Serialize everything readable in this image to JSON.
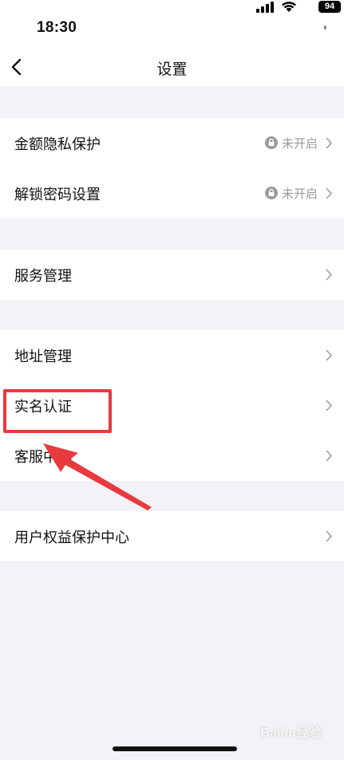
{
  "status_bar": {
    "time": "18:30",
    "battery": "94"
  },
  "nav": {
    "title": "设置"
  },
  "groups": [
    {
      "items": [
        {
          "label": "金额隐私保护",
          "status": "未开启",
          "has_lock": true
        },
        {
          "label": "解锁密码设置",
          "status": "未开启",
          "has_lock": true
        }
      ]
    },
    {
      "items": [
        {
          "label": "服务管理"
        }
      ]
    },
    {
      "items": [
        {
          "label": "地址管理"
        },
        {
          "label": "实名认证"
        },
        {
          "label": "客服中心"
        }
      ]
    },
    {
      "items": [
        {
          "label": "用户权益保护中心"
        }
      ]
    }
  ],
  "annotation": {
    "highlight_color": "#e8393f"
  },
  "watermark": "Baidu经验",
  "icons": [
    "signal-icon",
    "wifi-icon",
    "battery-icon",
    "back-icon",
    "lock-icon",
    "chevron-right-icon"
  ]
}
